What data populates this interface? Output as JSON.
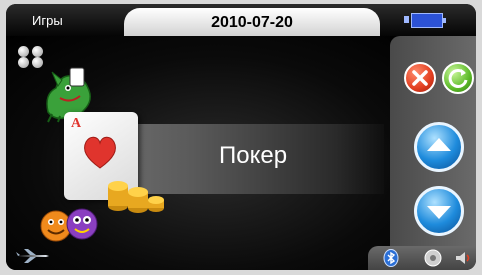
{
  "header": {
    "title": "Игры",
    "date": "2010-07-20",
    "battery_icon": "battery-icon"
  },
  "main": {
    "menu_icon": "apps-grid-icon",
    "selected_game": {
      "label": "Покер",
      "card_rank": "A",
      "card_suit": "heart"
    },
    "other_game_icons": [
      "dragon-icon",
      "smileys-icon",
      "plane-icon"
    ]
  },
  "right_panel": {
    "buttons": [
      "close-icon",
      "refresh-icon",
      "arrow-up-icon",
      "arrow-down-icon"
    ]
  },
  "status_bar": {
    "icons": [
      "bluetooth-icon",
      "media-icon",
      "speaker-icon"
    ]
  },
  "colors": {
    "accent_blue": "#1e8bdc",
    "close_red": "#e23e20",
    "refresh_green": "#5dbb28"
  }
}
